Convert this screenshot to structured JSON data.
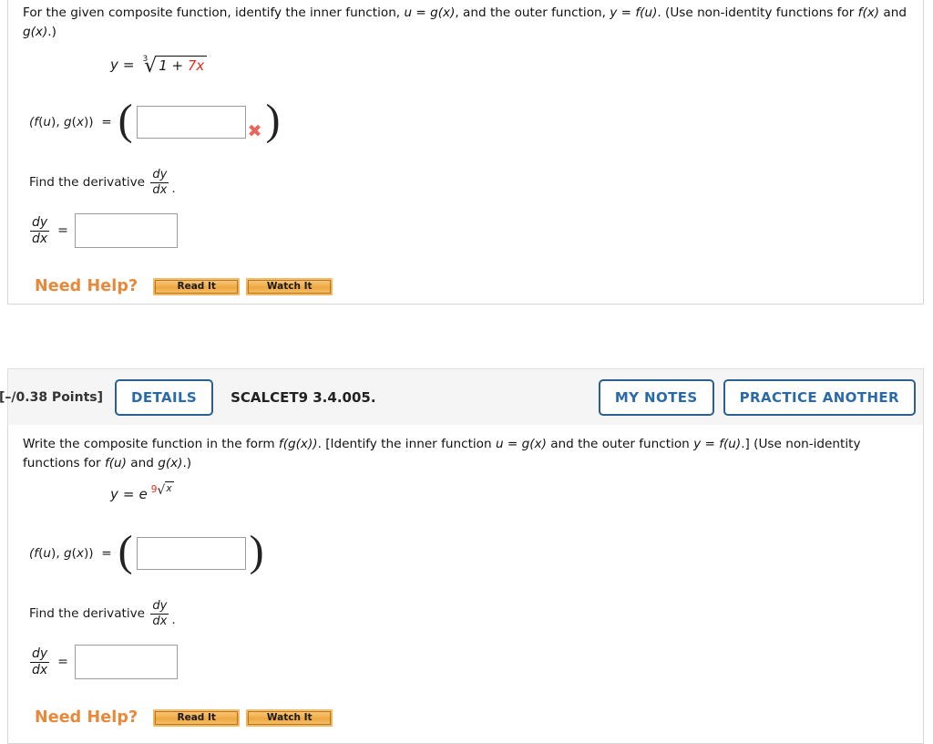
{
  "theme": {
    "accent_blue": "#2a6aa8",
    "border_blue": "#2a5f90",
    "orange": "#e8883a",
    "red_highlight": "#e8291c",
    "x_mark_red": "#e8645c",
    "panel_border": "#d6d6d6",
    "header_bg": "#f5f5f5"
  },
  "question1": {
    "prompt": {
      "part1": "For the given composite function, identify the inner function, ",
      "u": "u",
      "eq1": " = ",
      "gx": "g(x)",
      "part2": ", and the outer function, ",
      "y": "y",
      "eq2": " = ",
      "fu": "f(u)",
      "part3": ". (Use non-identity functions for ",
      "fx": "f(x)",
      "and": " and ",
      "gx2": "g(x)",
      "part4": ".)"
    },
    "equation": {
      "lead": "y",
      "eqsign": "=",
      "root_index": "3",
      "radical_sign": "√",
      "radicand_plain": "1 + ",
      "radicand_red": "7x"
    },
    "answer_row": {
      "label": "(f(u), g(x))  =",
      "paren_left": "(",
      "paren_right": ")",
      "input_value": "",
      "input_placeholder": "",
      "x_mark": "✖"
    },
    "derivative": {
      "text_before": "Find the derivative",
      "numerator": "dy",
      "denominator": "dx",
      "period": "."
    },
    "answer_derivative": {
      "numerator": "dy",
      "denominator": "dx",
      "eqsign": "=",
      "input_value": "",
      "input_placeholder": ""
    },
    "help": {
      "label": "Need Help?",
      "read_button": "Read It",
      "watch_button": "Watch It"
    }
  },
  "question2": {
    "header": {
      "points": "[–/0.38 Points]",
      "details_button": "DETAILS",
      "question_code": "SCALCET9 3.4.005.",
      "my_notes_button": "MY NOTES",
      "practice_another_button": "PRACTICE ANOTHER"
    },
    "prompt": {
      "part1": "Write the composite function in the form ",
      "fgx": "f(g(x))",
      "part2": ". [Identify the inner function ",
      "u": "u",
      "eq1": " = ",
      "gx": "g(x)",
      "part3": " and the outer function ",
      "y": "y",
      "eq2": " = ",
      "fu": "f(u)",
      "part4": ".] (Use non-identity functions for ",
      "fu2": "f(u)",
      "and": " and ",
      "gx2": "g(x)",
      "part5": ".)"
    },
    "equation": {
      "lead": "y",
      "eqsign": "=",
      "base": "e",
      "exponent_red": "9",
      "radical_sign": "√",
      "radicand": "x"
    },
    "answer_row": {
      "label": "(f(u), g(x))  =",
      "paren_left": "(",
      "paren_right": ")",
      "input_value": "",
      "input_placeholder": ""
    },
    "derivative": {
      "text_before": "Find the derivative",
      "numerator": "dy",
      "denominator": "dx",
      "period": "."
    },
    "answer_derivative": {
      "numerator": "dy",
      "denominator": "dx",
      "eqsign": "=",
      "input_value": "",
      "input_placeholder": ""
    },
    "help": {
      "label": "Need Help?",
      "read_button": "Read It",
      "watch_button": "Watch It"
    }
  }
}
